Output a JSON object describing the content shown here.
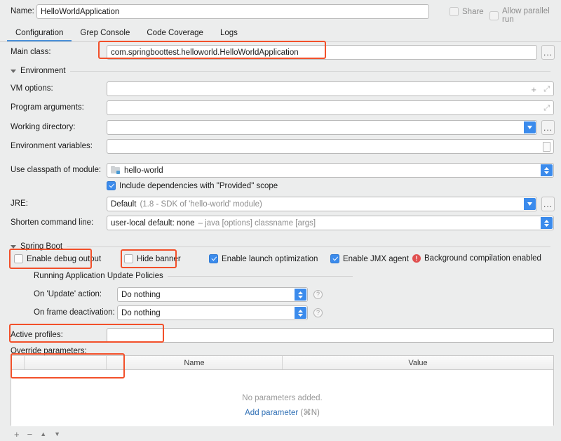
{
  "header": {
    "name_label": "Name:",
    "name_value": "HelloWorldApplication",
    "share_label": "Share",
    "parallel_label": "Allow parallel run"
  },
  "tabs": [
    {
      "label": "Configuration",
      "active": true
    },
    {
      "label": "Grep Console",
      "active": false
    },
    {
      "label": "Code Coverage",
      "active": false
    },
    {
      "label": "Logs",
      "active": false
    }
  ],
  "main_class": {
    "label": "Main class:",
    "value": "com.springboottest.helloworld.HelloWorldApplication",
    "browse": "..."
  },
  "environment": {
    "section_title": "Environment",
    "vm_options_label": "VM options:",
    "vm_options_value": "",
    "program_args_label": "Program arguments:",
    "program_args_value": "",
    "working_dir_label": "Working directory:",
    "working_dir_value": "",
    "env_vars_label": "Environment variables:",
    "env_vars_value": "",
    "browse": "..."
  },
  "classpath": {
    "label": "Use classpath of module:",
    "value": "hello-world",
    "provided_scope_label": "Include dependencies with \"Provided\" scope",
    "provided_scope_checked": true
  },
  "jre": {
    "label": "JRE:",
    "value": "Default",
    "value_hint": "(1.8 - SDK of 'hello-world' module)",
    "browse": "..."
  },
  "shorten": {
    "label": "Shorten command line:",
    "value": "user-local default: none",
    "value_hint": "– java [options] classname [args]"
  },
  "spring_boot": {
    "section_title": "Spring Boot",
    "checkboxes": [
      {
        "label": "Enable debug output",
        "checked": false
      },
      {
        "label": "Hide banner",
        "checked": false
      },
      {
        "label": "Enable launch optimization",
        "checked": true
      },
      {
        "label": "Enable JMX agent",
        "checked": true
      }
    ],
    "warning_text": "Background compilation enabled"
  },
  "update_policies": {
    "section_title": "Running Application Update Policies",
    "on_update_label": "On 'Update' action:",
    "on_update_value": "Do nothing",
    "on_frame_label": "On frame deactivation:",
    "on_frame_value": "Do nothing",
    "help": "?"
  },
  "active_profiles": {
    "label": "Active profiles:",
    "value": ""
  },
  "override_parameters": {
    "label": "Override parameters:",
    "columns": [
      "",
      "",
      "Name",
      "Value"
    ],
    "rows": [],
    "empty_message": "No parameters added.",
    "add_link": "Add parameter",
    "add_shortcut": "(⌘N)"
  },
  "toolbar": {
    "add": "+",
    "remove": "−",
    "up": "▲",
    "down": "▼"
  },
  "colors": {
    "annotation": "#f2502a",
    "accent": "#3b8bec",
    "link": "#2f6fb5",
    "error": "#e05050"
  }
}
